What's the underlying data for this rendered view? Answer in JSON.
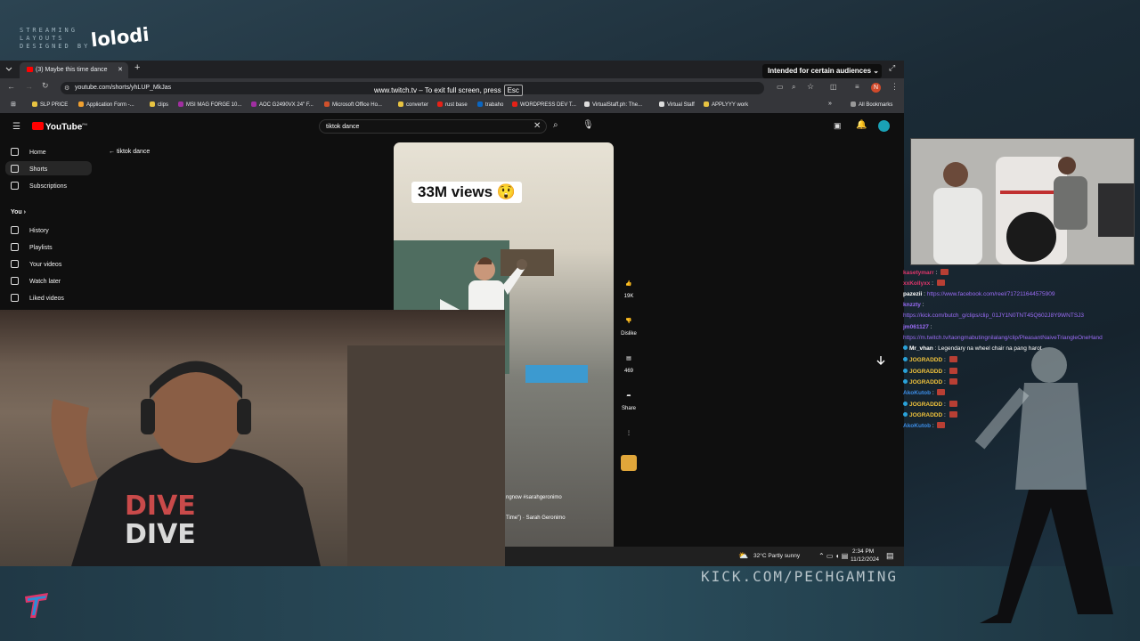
{
  "overlay": {
    "streaming_line1": "STREAMING",
    "streaming_line2": "LAYOUTS",
    "streaming_line3": "DESIGNED BY",
    "brand": "lolodi",
    "kick_url": "KICK.COM/PECHGAMING"
  },
  "browser": {
    "tab_title": "(3) Maybe this time dance",
    "url": "youtube.com/shorts/yhLUP_MkJas",
    "fullscreen_notice": "www.twitch.tv – To exit full screen, press",
    "fullscreen_key": "Esc",
    "audience_label": "Intended for certain audiences",
    "profile_letter": "N",
    "bookmarks": [
      {
        "label": "SLP PRICE",
        "color": "#e8c341"
      },
      {
        "label": "Application Form -...",
        "color": "#f0a030"
      },
      {
        "label": "clips",
        "color": "#e8c341"
      },
      {
        "label": "MSI MAG FORGE 10...",
        "color": "#a12fa1"
      },
      {
        "label": "AOC G2490VX 24\" F...",
        "color": "#a12fa1"
      },
      {
        "label": "Microsoft Office Ho...",
        "color": "#d0512c"
      },
      {
        "label": "converter",
        "color": "#e8c341"
      },
      {
        "label": "rust base",
        "color": "#e62117"
      },
      {
        "label": "trabaho",
        "color": "#0a66c2"
      },
      {
        "label": "WORDPRESS DEV T...",
        "color": "#e62117"
      },
      {
        "label": "VirtualStaff.ph: The...",
        "color": "#dddddd"
      },
      {
        "label": "Virtual Staff",
        "color": "#dddddd"
      },
      {
        "label": "APPLYYY work",
        "color": "#e8c341"
      }
    ],
    "all_bookmarks": "All Bookmarks"
  },
  "youtube": {
    "logo_text": "YouTube",
    "logo_region": "PH",
    "search_query": "tiktok dance",
    "back_label": "tiktok dance",
    "sidebar": {
      "home": "Home",
      "shorts": "Shorts",
      "subscriptions": "Subscriptions",
      "you": "You",
      "history": "History",
      "playlists": "Playlists",
      "your_videos": "Your videos",
      "watch_later": "Watch later",
      "liked_videos": "Liked videos"
    },
    "short": {
      "overlay_text": "33M views",
      "like_count": "19K",
      "dislike_label": "Dislike",
      "comment_count": "469",
      "share_label": "Share",
      "caption_hashtags": "ngnow #sarahgeronimo",
      "caption_song": "Time\") · Sarah Geronimo"
    }
  },
  "taskbar": {
    "weather": "32°C  Partly sunny",
    "time": "2:34 PM",
    "date": "11/12/2024"
  },
  "chat": [
    {
      "user": "kasetymarr",
      "color": "#e0356a",
      "text": "",
      "emote": true,
      "badge": false,
      "link": false
    },
    {
      "user": "xxKollyxx",
      "color": "#e0356a",
      "text": "",
      "emote": true,
      "badge": false,
      "link": false
    },
    {
      "user": "pazezii",
      "color": "#ffffff",
      "text": "https://www.facebook.com/reel/717211644575909",
      "emote": false,
      "badge": false,
      "link": true
    },
    {
      "user": "knzzty",
      "color": "#9b6cf7",
      "text": "",
      "emote": false,
      "badge": false,
      "link": false
    },
    {
      "user": "",
      "color": "#9b6cf7",
      "text": "https://kick.com/butch_g/clips/clip_01JY1N0TNT45Q602J8Y9WNTSJ3",
      "emote": false,
      "badge": false,
      "link": true
    },
    {
      "user": "jm061127",
      "color": "#9b6cf7",
      "text": "",
      "emote": false,
      "badge": false,
      "link": false
    },
    {
      "user": "",
      "color": "#9b6cf7",
      "text": "https://m.twitch.tv/taongmabutingnilalang/clip/PleasantNaiveTriangleOneHand",
      "emote": false,
      "badge": false,
      "link": true
    },
    {
      "user": "Mr_vhan",
      "color": "#ffffff",
      "text": "Legendary na wheel chair na pang harot",
      "emote": false,
      "badge": true,
      "link": false
    },
    {
      "user": "JOGRADDD",
      "color": "#f0c33c",
      "text": "",
      "emote": true,
      "badge": true,
      "link": false
    },
    {
      "user": "JOGRADDD",
      "color": "#f0c33c",
      "text": "",
      "emote": true,
      "badge": true,
      "link": false
    },
    {
      "user": "JOGRADDD",
      "color": "#f0c33c",
      "text": "",
      "emote": true,
      "badge": true,
      "link": false
    },
    {
      "user": "AkoKutob",
      "color": "#3c8de6",
      "text": "",
      "emote": true,
      "badge": false,
      "link": false
    },
    {
      "user": "JOGRADDD",
      "color": "#f0c33c",
      "text": "",
      "emote": true,
      "badge": true,
      "link": false
    },
    {
      "user": "JOGRADDD",
      "color": "#f0c33c",
      "text": "",
      "emote": true,
      "badge": true,
      "link": false
    },
    {
      "user": "AkoKutob",
      "color": "#3c8de6",
      "text": "",
      "emote": true,
      "badge": false,
      "link": false
    }
  ]
}
